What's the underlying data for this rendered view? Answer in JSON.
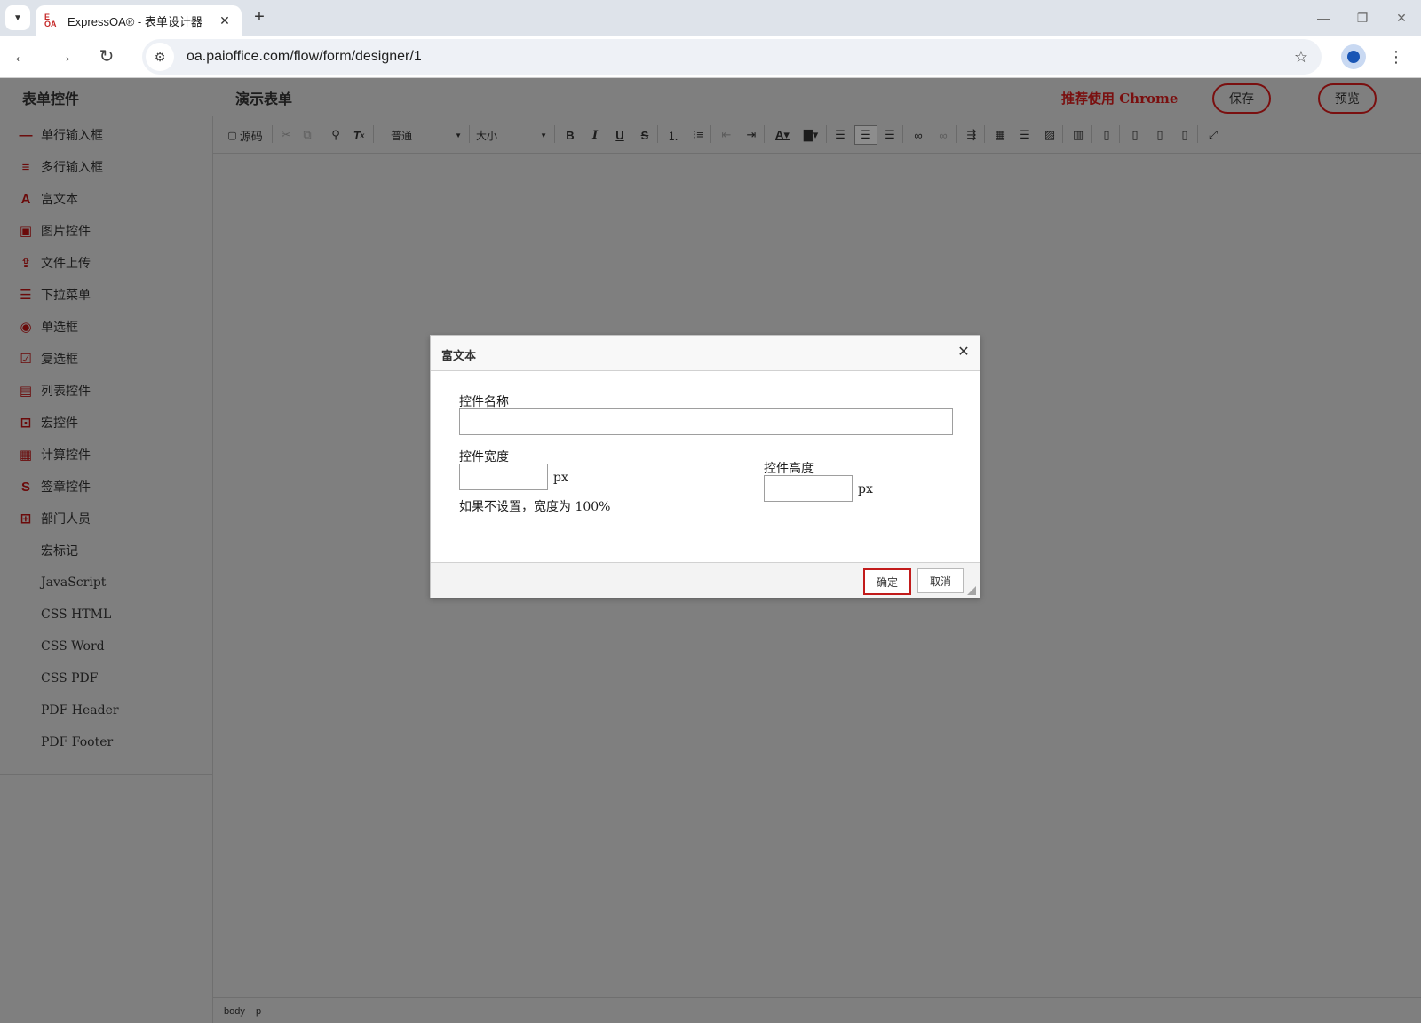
{
  "browser": {
    "tab_title": "ExpressOA® - 表单设计器",
    "tab_favicon": "E OA",
    "url": "oa.paioffice.com/flow/form/designer/1"
  },
  "header": {
    "panel_title": "表单控件",
    "form_title": "演示表单",
    "recommend": "推荐使用 Chrome",
    "save_label": "保存",
    "preview_label": "预览"
  },
  "sidebar": {
    "items": [
      {
        "label": "单行输入框",
        "icon": "single-line-input-icon",
        "glyph": "—"
      },
      {
        "label": "多行输入框",
        "icon": "multi-line-input-icon",
        "glyph": "≡"
      },
      {
        "label": "富文本",
        "icon": "rich-text-icon",
        "glyph": "A"
      },
      {
        "label": "图片控件",
        "icon": "image-control-icon",
        "glyph": "▣"
      },
      {
        "label": "文件上传",
        "icon": "file-upload-icon",
        "glyph": "⇪"
      },
      {
        "label": "下拉菜单",
        "icon": "dropdown-menu-icon",
        "glyph": "☰"
      },
      {
        "label": "单选框",
        "icon": "radio-icon",
        "glyph": "◉"
      },
      {
        "label": "复选框",
        "icon": "checkbox-icon",
        "glyph": "☑"
      },
      {
        "label": "列表控件",
        "icon": "list-control-icon",
        "glyph": "▤"
      },
      {
        "label": "宏控件",
        "icon": "macro-control-icon",
        "glyph": "⊡"
      },
      {
        "label": "计算控件",
        "icon": "calculator-icon",
        "glyph": "▦"
      },
      {
        "label": "签章控件",
        "icon": "signature-icon",
        "glyph": "S"
      },
      {
        "label": "部门人员",
        "icon": "department-personnel-icon",
        "glyph": "⊞"
      },
      {
        "label": "宏标记",
        "icon": "",
        "glyph": ""
      },
      {
        "label": "JavaScript",
        "icon": "",
        "glyph": ""
      },
      {
        "label": "CSS HTML",
        "icon": "",
        "glyph": ""
      },
      {
        "label": "CSS Word",
        "icon": "",
        "glyph": ""
      },
      {
        "label": "CSS PDF",
        "icon": "",
        "glyph": ""
      },
      {
        "label": "PDF Header",
        "icon": "",
        "glyph": ""
      },
      {
        "label": "PDF Footer",
        "icon": "",
        "glyph": ""
      }
    ]
  },
  "toolbar": {
    "source_label": "源码",
    "format_value": "普通",
    "size_value": "大小",
    "icons": [
      "cut-icon",
      "copy-icon",
      "find-icon",
      "remove-format-icon",
      "bold-icon",
      "italic-icon",
      "underline-icon",
      "strikethrough-icon",
      "numbered-list-icon",
      "bulleted-list-icon",
      "outdent-icon",
      "indent-icon",
      "text-color-icon",
      "background-color-icon",
      "align-left-icon",
      "align-center-icon",
      "align-right-icon",
      "link-icon",
      "unlink-icon",
      "text-direction-icon",
      "table-icon",
      "horizontal-line-icon",
      "image-icon",
      "iframe-icon",
      "template-icon",
      "word-export-icon",
      "word-import-icon",
      "pdf-export-icon",
      "maximize-icon"
    ]
  },
  "status": {
    "path_1": "body",
    "path_2": "p"
  },
  "dialog": {
    "title": "富文本",
    "name_label": "控件名称",
    "name_value": "",
    "width_label": "控件宽度",
    "width_value": "",
    "width_unit": "px",
    "width_hint": "如果不设置，宽度为 100%",
    "height_label": "控件高度",
    "height_value": "",
    "height_unit": "px",
    "ok_label": "确定",
    "cancel_label": "取消"
  },
  "colors": {
    "accent": "#7a0f0f",
    "overlay": "#7f7f7f",
    "ok_border": "#c21b1b"
  }
}
